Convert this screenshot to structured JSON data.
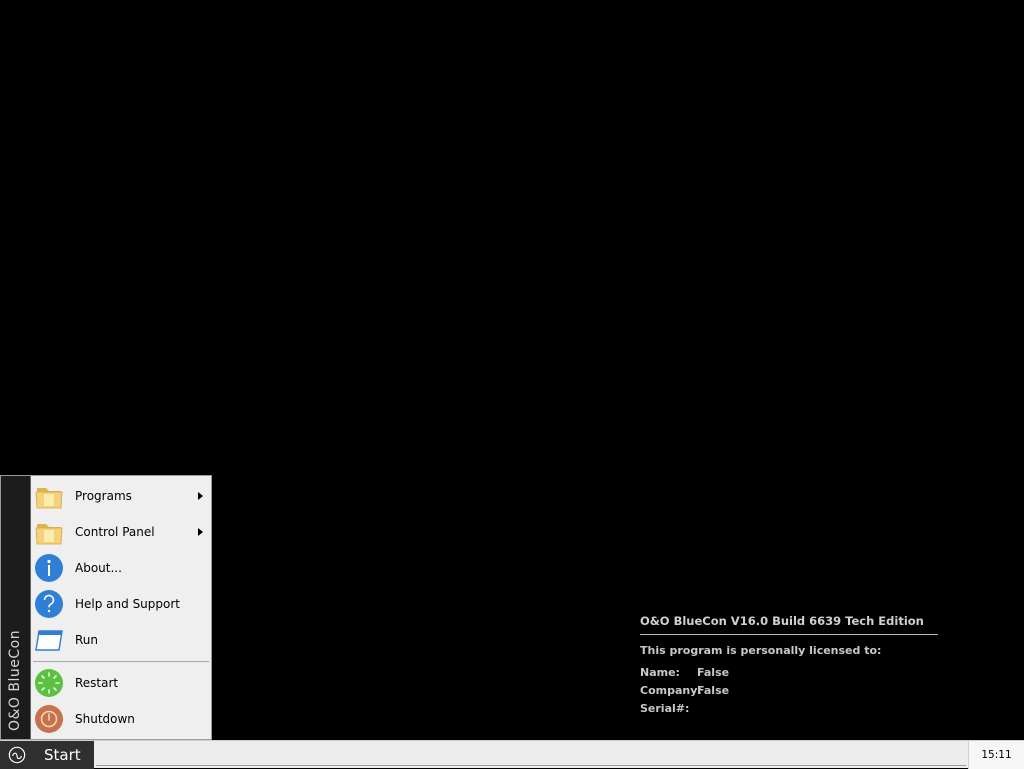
{
  "license": {
    "product": "O&O BlueCon V16.0 Build 6639 Tech Edition",
    "licensed_to": "This program is personally licensed to:",
    "name_label": "Name:",
    "name_value": "False",
    "company_label": "Company:",
    "company_value": "False",
    "serial_label": "Serial#:",
    "serial_value": ""
  },
  "start_menu": {
    "banner": "O&O BlueCon",
    "items": [
      {
        "label": "Programs",
        "icon": "folder-icon",
        "submenu": true
      },
      {
        "label": "Control Panel",
        "icon": "folder-icon",
        "submenu": true
      },
      {
        "label": "About...",
        "icon": "info-icon",
        "submenu": false
      },
      {
        "label": "Help and Support",
        "icon": "help-icon",
        "submenu": false
      },
      {
        "label": "Run",
        "icon": "run-window-icon",
        "submenu": false
      },
      {
        "label": "Restart",
        "icon": "restart-icon",
        "submenu": false
      },
      {
        "label": "Shutdown",
        "icon": "power-icon",
        "submenu": false
      }
    ]
  },
  "taskbar": {
    "start_label": "Start",
    "clock": "15:11"
  },
  "colors": {
    "desktop": "#000000",
    "menu_bg": "#efefef",
    "banner_bg": "#1c1c1c",
    "info_blue": "#2f7fd6",
    "restart_green": "#5cc043",
    "shutdown_orange": "#c8724a",
    "folder_yellow": "#f3d27a"
  }
}
